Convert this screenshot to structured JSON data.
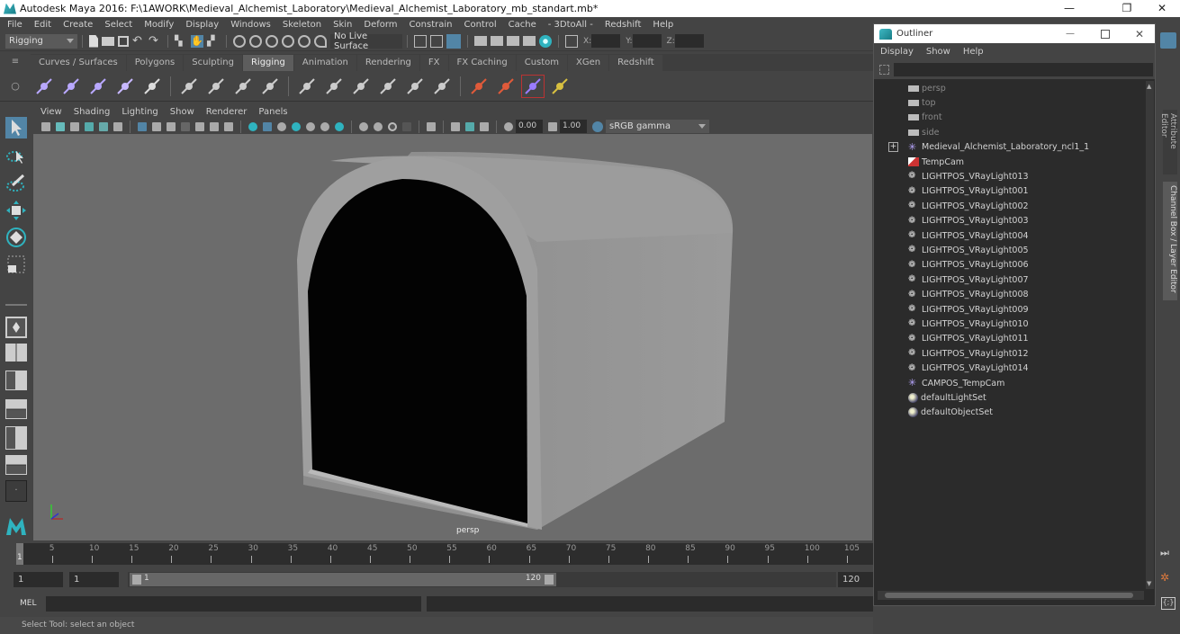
{
  "window": {
    "title": "Autodesk Maya 2016: F:\\1AWORK\\Medieval_Alchemist_Laboratory\\Medieval_Alchemist_Laboratory_mb_standart.mb*",
    "minimize": "—",
    "maximize": "❐",
    "close": "✕"
  },
  "menubar": [
    "File",
    "Edit",
    "Create",
    "Select",
    "Modify",
    "Display",
    "Windows",
    "Skeleton",
    "Skin",
    "Deform",
    "Constrain",
    "Control",
    "Cache",
    "- 3DtoAll -",
    "Redshift",
    "Help"
  ],
  "statusline": {
    "menuset": "Rigging",
    "live_surface": "No Live Surface",
    "x_label": "X:",
    "y_label": "Y:",
    "z_label": "Z:",
    "x_value": "",
    "y_value": "",
    "z_value": ""
  },
  "shelf": {
    "tabs": [
      "Curves / Surfaces",
      "Polygons",
      "Sculpting",
      "Rigging",
      "Animation",
      "Rendering",
      "FX",
      "FX Caching",
      "Custom",
      "XGen",
      "Redshift"
    ],
    "active_tab": "Rigging",
    "icons": [
      "joint-tool-icon",
      "ik-handle-icon",
      "ik-spline-icon",
      "insert-joint-icon",
      "humanik-icon",
      "smooth-bind-icon",
      "interactive-bind-icon",
      "lattice-icon",
      "cluster-icon",
      "parent-constraint-icon",
      "point-constraint-icon",
      "orient-constraint-icon",
      "scale-constraint-icon",
      "aim-constraint-icon",
      "pole-vector-icon",
      "locator-icon",
      "joint-orient-icon",
      "3dtoall-icon",
      "layers-icon"
    ]
  },
  "panel": {
    "menus": [
      "View",
      "Shading",
      "Lighting",
      "Show",
      "Renderer",
      "Panels"
    ],
    "exposure": "0.00",
    "gamma": "1.00",
    "color_space": "sRGB gamma",
    "camera_label": "persp"
  },
  "toolbox": [
    "select-tool-icon",
    "lasso-tool-icon",
    "paint-select-icon",
    "move-tool-icon",
    "rotate-tool-icon",
    "scale-tool-icon",
    "single-perspective-layout-icon",
    "four-view-layout-icon",
    "persp-outliner-layout-icon",
    "persp-graph-layout-icon",
    "persp-hypershade-layout-icon",
    "persp-graph-hypershade-layout-icon",
    "outliner-toggle-icon",
    "maya-logo-icon"
  ],
  "timeline": {
    "ticks": [
      5,
      10,
      15,
      20,
      25,
      30,
      35,
      40,
      45,
      50,
      55,
      60,
      65,
      70,
      75,
      80,
      85,
      90,
      95,
      100,
      105
    ],
    "current_frame": "1",
    "start_frame": "1",
    "playback_start": "1",
    "range_start": "1",
    "range_end": "120",
    "playback_end": "120"
  },
  "command": {
    "language": "MEL"
  },
  "helpline": "Select Tool: select an object",
  "outliner": {
    "title": "Outliner",
    "menus": [
      "Display",
      "Show",
      "Help"
    ],
    "items": [
      {
        "label": "persp",
        "type": "camera",
        "dim": true
      },
      {
        "label": "top",
        "type": "camera",
        "dim": true
      },
      {
        "label": "front",
        "type": "camera",
        "dim": true
      },
      {
        "label": "side",
        "type": "camera",
        "dim": true
      },
      {
        "label": "Medieval_Alchemist_Laboratory_ncl1_1",
        "type": "locator",
        "expand": true
      },
      {
        "label": "TempCam",
        "type": "camera-red"
      },
      {
        "label": "LIGHTPOS_VRayLight013",
        "type": "light"
      },
      {
        "label": "LIGHTPOS_VRayLight001",
        "type": "light"
      },
      {
        "label": "LIGHTPOS_VRayLight002",
        "type": "light"
      },
      {
        "label": "LIGHTPOS_VRayLight003",
        "type": "light"
      },
      {
        "label": "LIGHTPOS_VRayLight004",
        "type": "light"
      },
      {
        "label": "LIGHTPOS_VRayLight005",
        "type": "light"
      },
      {
        "label": "LIGHTPOS_VRayLight006",
        "type": "light"
      },
      {
        "label": "LIGHTPOS_VRayLight007",
        "type": "light"
      },
      {
        "label": "LIGHTPOS_VRayLight008",
        "type": "light"
      },
      {
        "label": "LIGHTPOS_VRayLight009",
        "type": "light"
      },
      {
        "label": "LIGHTPOS_VRayLight010",
        "type": "light"
      },
      {
        "label": "LIGHTPOS_VRayLight011",
        "type": "light"
      },
      {
        "label": "LIGHTPOS_VRayLight012",
        "type": "light"
      },
      {
        "label": "LIGHTPOS_VRayLight014",
        "type": "light"
      },
      {
        "label": "CAMPOS_TempCam",
        "type": "locator"
      },
      {
        "label": "defaultLightSet",
        "type": "set"
      },
      {
        "label": "defaultObjectSet",
        "type": "set"
      }
    ]
  },
  "side_tabs": [
    "Attribute Editor",
    "Channel Box / Layer Editor"
  ],
  "colors": {
    "accent": "#5285a6",
    "maya_teal": "#2fb3bf",
    "viewport_bg": "#6c6c6c"
  }
}
